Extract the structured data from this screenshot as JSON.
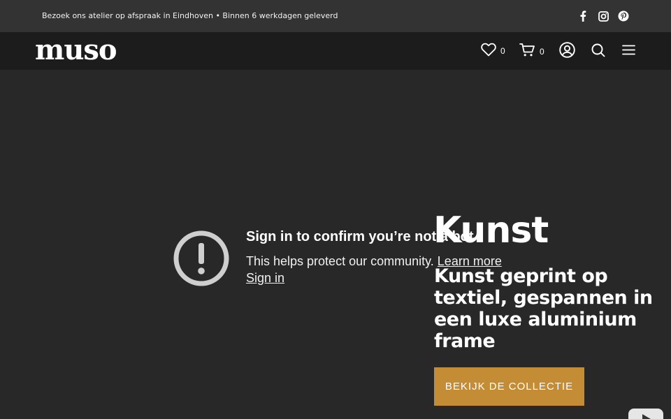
{
  "topbar": {
    "text": "Bezoek ons atelier op afspraak in Eindhoven • Binnen 6 werkdagen geleverd",
    "social": [
      "facebook-icon",
      "instagram-icon",
      "pinterest-icon"
    ]
  },
  "header": {
    "logo": "muso",
    "wishlist_count": "0",
    "cart_count": "0",
    "icons": [
      "heart-icon",
      "cart-icon",
      "account-icon",
      "search-icon",
      "menu-icon"
    ]
  },
  "video": {
    "title": "Sign in to confirm you’re not a bot",
    "subtitle": "This helps protect our community.",
    "learn_more": "Learn more",
    "sign_in": "Sign in"
  },
  "hero": {
    "title": "Kunst",
    "subtitle": "Kunst geprint op textiel, gespannen in een luxe aluminium frame",
    "cta": "BEKIJK DE COLLECTIE"
  },
  "colors": {
    "topbar_bg": "#333333",
    "navbar_bg": "#1c1c1c",
    "page_bg": "#282828",
    "cta_bg": "#c48c35"
  }
}
